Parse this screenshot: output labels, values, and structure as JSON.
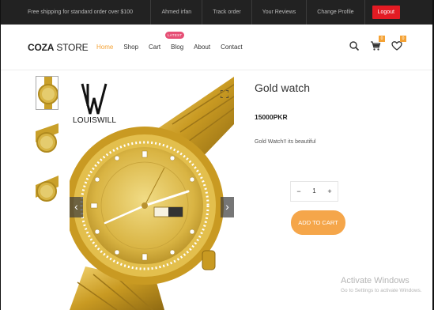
{
  "topbar": {
    "shipping_text": "Free shipping for standard order over $100",
    "links": [
      "Ahmed irfan",
      "Track order",
      "Your Reviews",
      "Change Profile"
    ],
    "logout_label": "Logout"
  },
  "header": {
    "logo_bold": "COZA",
    "logo_rest": " STORE",
    "nav": [
      "Home",
      "Shop",
      "Cart",
      "Blog",
      "About",
      "Contact"
    ],
    "active_nav": "Home",
    "latest_badge": "LATEST",
    "cart_count": "0",
    "wishlist_count": "0",
    "icons": [
      "search-icon",
      "cart-icon",
      "heart-icon"
    ]
  },
  "gallery": {
    "brand_name": "LOUISWILL",
    "icons": [
      "chevron-left-icon",
      "chevron-right-icon",
      "expand-icon"
    ]
  },
  "product": {
    "title": "Gold watch",
    "price": "15000PKR",
    "description": "Gold Watch!! its beautiful",
    "quantity": "1",
    "minus_label": "−",
    "plus_label": "+",
    "add_to_cart_label": "ADD TO CART"
  },
  "watermark": {
    "line1": "Activate Windows",
    "line2": "Go to Settings to activate Windows."
  },
  "colors": {
    "accent": "#f4a235",
    "topbar_bg": "#222222",
    "logout_red": "#e31b23",
    "badge_pink": "#e64f75"
  }
}
